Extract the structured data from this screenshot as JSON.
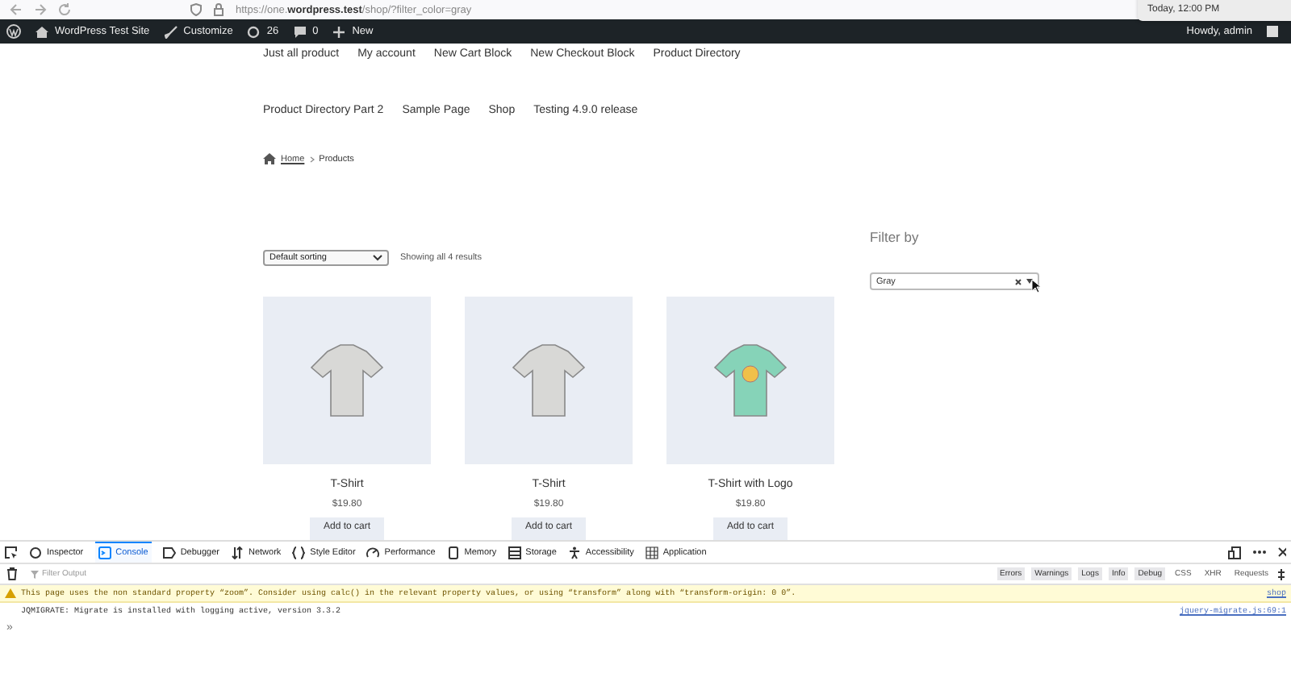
{
  "browser": {
    "url": "https://one.**wordpress.test**/shop/?filter_color=gray",
    "notification": {
      "time": "Today, 12:00 PM"
    }
  },
  "admin_bar": {
    "site": "WordPress Test Site",
    "customize": "Customize",
    "updates": "26",
    "comments": "0",
    "new": "New",
    "greeting": "Howdy, admin"
  },
  "nav": [
    "Just all product",
    "My account",
    "New Cart Block",
    "New Checkout Block",
    "Product Directory",
    "Product Directory Part 2",
    "Sample Page",
    "Shop",
    "Testing 4.9.0 release"
  ],
  "breadcrumb": [
    "Home",
    "Products"
  ],
  "sorting": {
    "value": "Default sorting"
  },
  "result_count": "Showing all 4 results",
  "products": [
    {
      "kind": "plain",
      "title": "T-Shirt",
      "price": "$19.80",
      "button": "Add to cart"
    },
    {
      "kind": "plain",
      "title": "T-Shirt",
      "price": "$19.80",
      "button": "Add to cart"
    },
    {
      "kind": "logo",
      "title": "T-Shirt with Logo",
      "price": "$19.80",
      "button": "Add to cart"
    }
  ],
  "filter": {
    "title": "Filter by",
    "value": "Gray"
  },
  "devtools": {
    "tabs": [
      {
        "label": "Inspector",
        "selected": false
      },
      {
        "label": "Console",
        "selected": true
      },
      {
        "label": "Debugger",
        "selected": false
      },
      {
        "label": "Network",
        "selected": false
      },
      {
        "label": "Style Editor",
        "selected": false
      },
      {
        "label": "Performance",
        "selected": false
      },
      {
        "label": "Memory",
        "selected": false
      },
      {
        "label": "Storage",
        "selected": false
      },
      {
        "label": "Accessibility",
        "selected": false
      },
      {
        "label": "Application",
        "selected": false
      }
    ],
    "filter_placeholder": "Filter Output",
    "levels": [
      {
        "label": "Errors",
        "on": true
      },
      {
        "label": "Warnings",
        "on": true
      },
      {
        "label": "Logs",
        "on": true
      },
      {
        "label": "Info",
        "on": true
      },
      {
        "label": "Debug",
        "on": true
      },
      {
        "label": "CSS",
        "on": false
      },
      {
        "label": "XHR",
        "on": false
      },
      {
        "label": "Requests",
        "on": false
      }
    ],
    "messages": [
      {
        "kind": "warning",
        "text": "This page uses the non standard property “zoom”. Consider using calc() in the relevant property values, or using “transform” along with “transform-origin: 0 0”.",
        "source": "shop"
      },
      {
        "kind": "log",
        "text": "JQMIGRATE: Migrate is installed with logging active, version 3.3.2",
        "source": "jquery-migrate.js:69:1"
      }
    ],
    "prompt": "»"
  }
}
